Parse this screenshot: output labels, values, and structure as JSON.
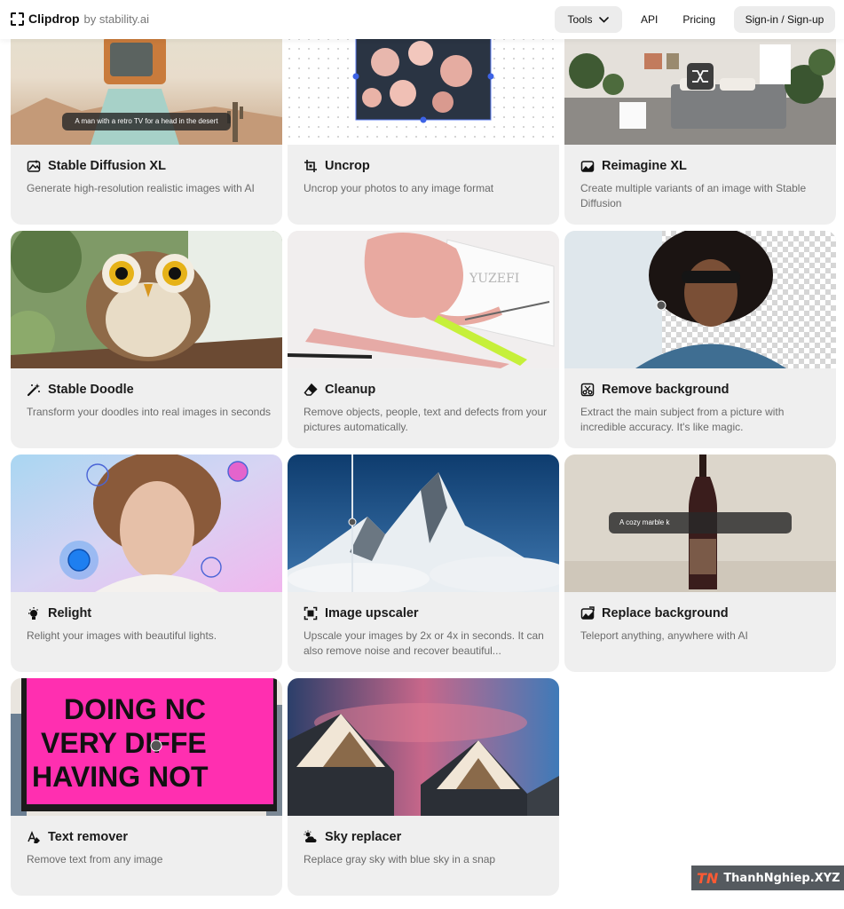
{
  "header": {
    "brand": "Clipdrop",
    "brand_by": "by stability.ai",
    "tools_label": "Tools",
    "api_label": "API",
    "pricing_label": "Pricing",
    "sign_label": "Sign-in / Sign-up"
  },
  "cards": [
    {
      "title": "Stable Diffusion XL",
      "description": "Generate high-resolution realistic images with AI",
      "icon": "image-sparkle-icon",
      "overlay": "A man with a retro TV for a head in the desert"
    },
    {
      "title": "Uncrop",
      "description": "Uncrop your photos to any image format",
      "icon": "crop-icon"
    },
    {
      "title": "Reimagine XL",
      "description": "Create multiple variants of an image with Stable Diffusion",
      "icon": "image-variants-icon"
    },
    {
      "title": "Stable Doodle",
      "description": "Transform your doodles into real images in seconds",
      "icon": "magic-wand-icon"
    },
    {
      "title": "Cleanup",
      "description": "Remove objects, people, text and defects from your pictures automatically.",
      "icon": "eraser-icon"
    },
    {
      "title": "Remove background",
      "description": "Extract the main subject from a picture with incredible accuracy. It's like magic.",
      "icon": "scissors-icon"
    },
    {
      "title": "Relight",
      "description": "Relight your images with beautiful lights.",
      "icon": "lightbulb-icon"
    },
    {
      "title": "Image upscaler",
      "description": "Upscale your images by 2x or 4x in seconds. It can also remove noise and recover beautiful...",
      "icon": "upscale-icon"
    },
    {
      "title": "Replace background",
      "description": "Teleport anything, anywhere with AI",
      "icon": "replace-image-icon",
      "overlay": "A cozy marble k"
    },
    {
      "title": "Text remover",
      "description": "Remove text from any image",
      "icon": "text-remove-icon",
      "billboard": [
        "DOING NC",
        "VERY DIFFE",
        "HAVING NOT"
      ]
    },
    {
      "title": "Sky replacer",
      "description": "Replace gray sky with blue sky in a snap",
      "icon": "sky-icon"
    }
  ],
  "watermark": {
    "logo": "TN",
    "text": "ThanhNghiep.XYZ"
  }
}
